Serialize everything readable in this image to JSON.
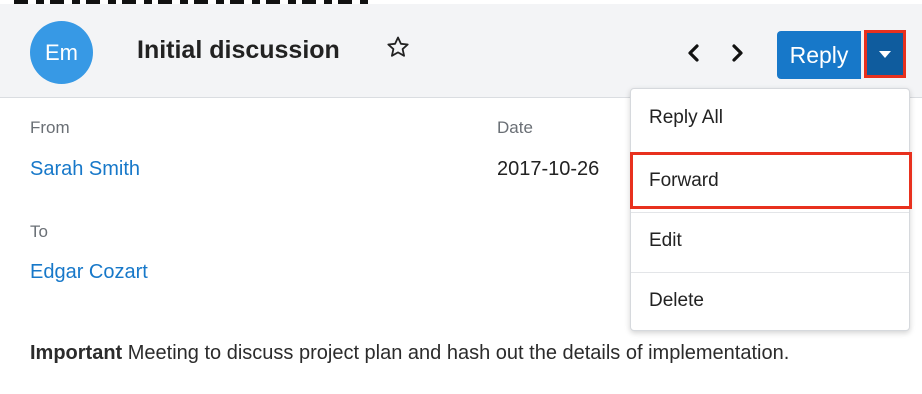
{
  "header": {
    "avatar_text": "Em",
    "title": "Initial discussion",
    "reply_label": "Reply"
  },
  "details": {
    "from_label": "From",
    "from_value": "Sarah Smith",
    "date_label": "Date",
    "date_value": "2017-10-26",
    "to_label": "To",
    "to_value": "Edgar Cozart"
  },
  "description": {
    "emphasis": "Important",
    "text": " Meeting to discuss project plan and hash out the details of implementation."
  },
  "menu": {
    "items": [
      {
        "label": "Reply All"
      },
      {
        "label": "Forward"
      },
      {
        "label": "Edit"
      },
      {
        "label": "Delete"
      }
    ]
  },
  "colors": {
    "accent": "#1778c9",
    "avatar": "#3799e5",
    "highlight": "#e8311e"
  }
}
